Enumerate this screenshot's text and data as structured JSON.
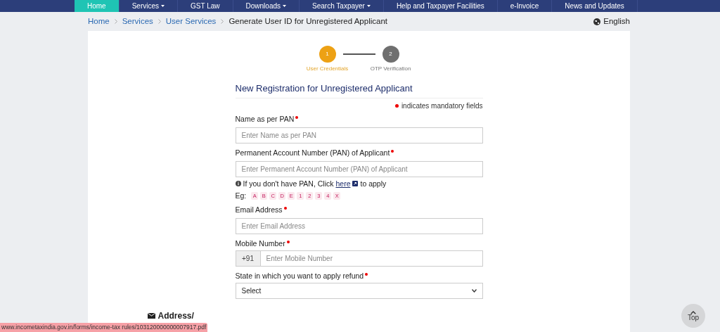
{
  "nav": [
    {
      "label": "Home",
      "selected": true,
      "caret": false
    },
    {
      "label": "Services",
      "selected": false,
      "caret": true
    },
    {
      "label": "GST Law",
      "selected": false,
      "caret": false
    },
    {
      "label": "Downloads",
      "selected": false,
      "caret": true
    },
    {
      "label": "Search Taxpayer",
      "selected": false,
      "caret": true
    },
    {
      "label": "Help and Taxpayer Facilities",
      "selected": false,
      "caret": false
    },
    {
      "label": "e-Invoice",
      "selected": false,
      "caret": false
    },
    {
      "label": "News and Updates",
      "selected": false,
      "caret": false
    }
  ],
  "breadcrumb": [
    {
      "label": "Home",
      "link": true
    },
    {
      "label": "Services",
      "link": true
    },
    {
      "label": "User Services",
      "link": true
    },
    {
      "label": "Generate User ID for Unregistered Applicant",
      "link": false
    }
  ],
  "language": "English",
  "steps": [
    {
      "number": "1",
      "label": "User Credentials",
      "selected": true
    },
    {
      "number": "2",
      "label": "OTP Verification",
      "selected": false
    }
  ],
  "form": {
    "title": "New Registration for Unregistered Applicant",
    "mandatory_note": "indicates mandatory fields",
    "fields": [
      {
        "kind": "text",
        "label": "Name as per PAN",
        "required": true,
        "placeholder": "Enter Name as per PAN"
      },
      {
        "kind": "text",
        "label": "Permanent Account Number (PAN) of Applicant",
        "required": true,
        "placeholder": "Enter Permanent Account Number (PAN) of Applicant",
        "hint": {
          "before": "If you don't have PAN, Click",
          "link": "here",
          "after": "to apply"
        },
        "example": {
          "label": "Eg:",
          "chars": [
            "A",
            "B",
            "C",
            "D",
            "E",
            "1",
            "2",
            "3",
            "4",
            "X"
          ]
        }
      },
      {
        "kind": "text",
        "label": "Email Address",
        "required": true,
        "placeholder": "Enter Email Address"
      },
      {
        "kind": "phone",
        "label": "Mobile Number",
        "required": true,
        "prefix": "+91",
        "placeholder": "Enter Mobile Number"
      },
      {
        "kind": "select",
        "label": "State in which you want to apply refund",
        "required": true,
        "value": "Select"
      }
    ],
    "next_section": "Address/"
  },
  "status_url": "www.incometaxindia.gov.in/forms/income-tax rules/103120000000007917.pdf",
  "top_button": "Top"
}
